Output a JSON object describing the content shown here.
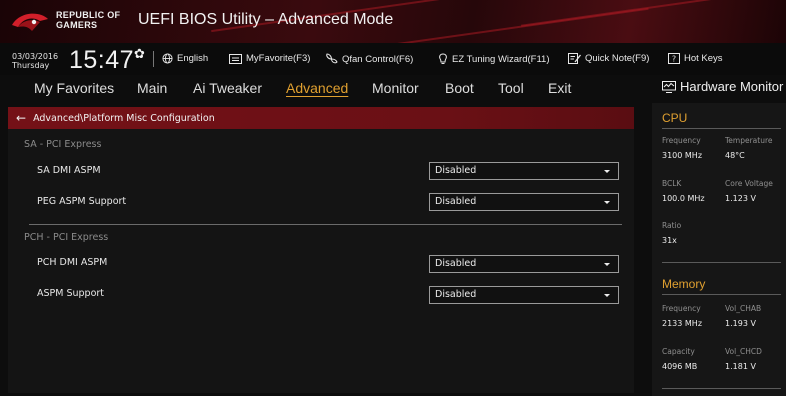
{
  "titlebar": {
    "brand_line1": "REPUBLIC OF",
    "brand_line2": "GAMERS",
    "title": "UEFI BIOS Utility – Advanced Mode",
    "logo_icon": "rog-eye-icon"
  },
  "toolbar": {
    "date": "03/03/2016",
    "day": "Thursday",
    "time": "15:47",
    "items": [
      {
        "icon": "globe-icon",
        "label": "English"
      },
      {
        "icon": "favorite-icon",
        "label": "MyFavorite(F3)"
      },
      {
        "icon": "fan-icon",
        "label": "Qfan Control(F6)"
      },
      {
        "icon": "bulb-icon",
        "label": "EZ Tuning Wizard(F11)"
      },
      {
        "icon": "note-icon",
        "label": "Quick Note(F9)"
      },
      {
        "icon": "help-icon",
        "label": "Hot Keys"
      }
    ]
  },
  "menu": {
    "items": [
      "My Favorites",
      "Main",
      "Ai Tweaker",
      "Advanced",
      "Monitor",
      "Boot",
      "Tool",
      "Exit"
    ],
    "active": "Advanced"
  },
  "breadcrumb": "Advanced\\Platform Misc Configuration",
  "settings": {
    "section1": "SA - PCI Express",
    "sa_dmi_aspm": {
      "label": "SA DMI ASPM",
      "value": "Disabled"
    },
    "peg_aspm": {
      "label": "PEG ASPM Support",
      "value": "Disabled"
    },
    "section2": "PCH - PCI Express",
    "pch_dmi_aspm": {
      "label": "PCH DMI ASPM",
      "value": "Disabled"
    },
    "aspm_support": {
      "label": "ASPM Support",
      "value": "Disabled"
    }
  },
  "hardware_monitor": {
    "title": "Hardware Monitor",
    "cpu": {
      "heading": "CPU",
      "frequency_label": "Frequency",
      "frequency": "3100 MHz",
      "temperature_label": "Temperature",
      "temperature": "48°C",
      "bclk_label": "BCLK",
      "bclk": "100.0 MHz",
      "core_voltage_label": "Core Voltage",
      "core_voltage": "1.123 V",
      "ratio_label": "Ratio",
      "ratio": "31x"
    },
    "memory": {
      "heading": "Memory",
      "frequency_label": "Frequency",
      "frequency": "2133 MHz",
      "vol_chab_label": "Vol_CHAB",
      "vol_chab": "1.193 V",
      "capacity_label": "Capacity",
      "capacity": "4096 MB",
      "vol_chcd_label": "Vol_CHCD",
      "vol_chcd": "1.181 V"
    }
  },
  "colors": {
    "accent": "#e0a030",
    "breadcrumb_bg": "#741117",
    "background": "#0d0d0d"
  }
}
